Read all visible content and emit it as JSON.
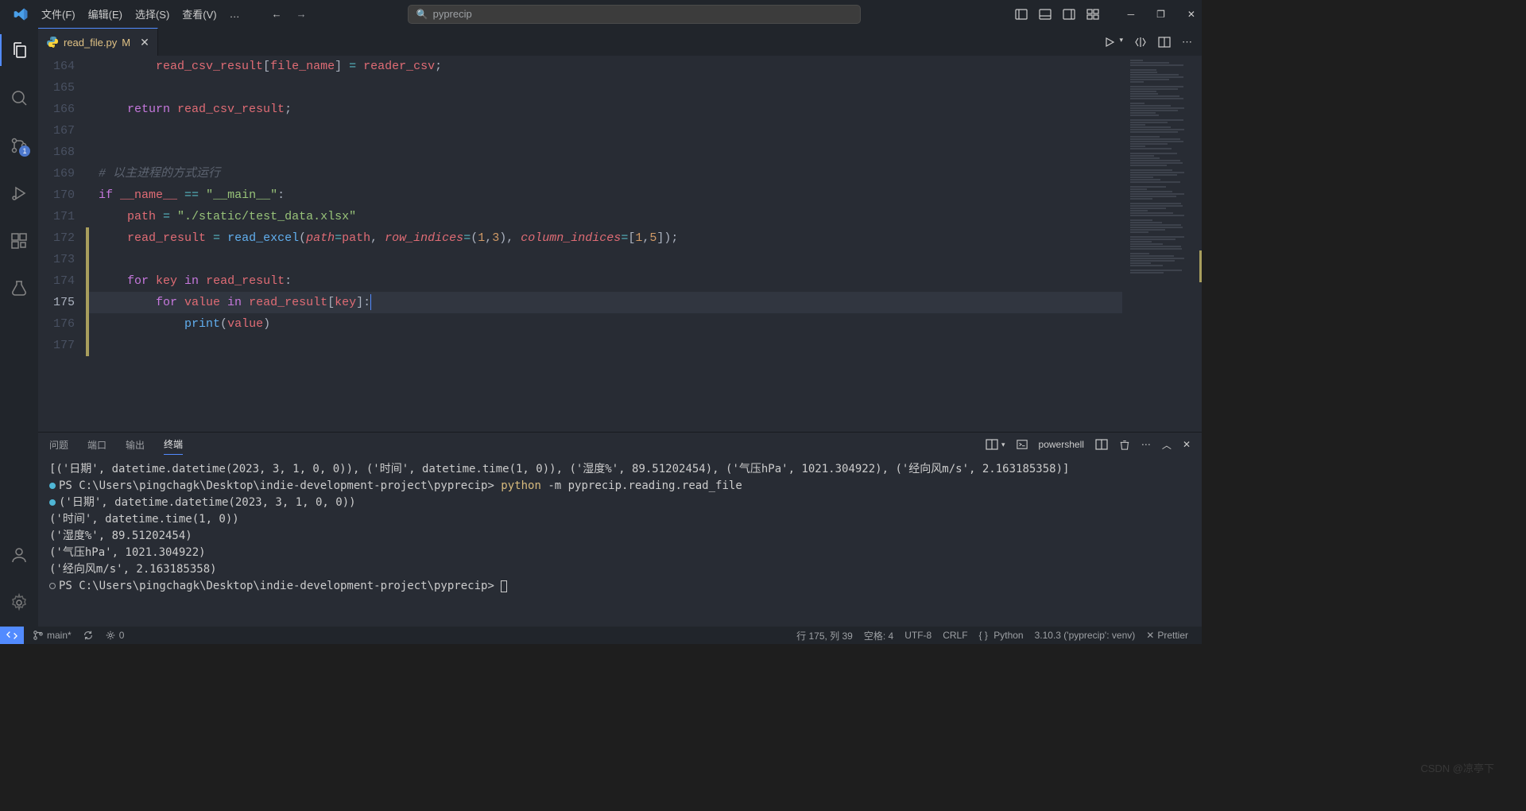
{
  "menu": {
    "file": "文件(F)",
    "edit": "编辑(E)",
    "select": "选择(S)",
    "view": "查看(V)",
    "dots": "…"
  },
  "search": {
    "placeholder": "pyprecip"
  },
  "tab": {
    "filename": "read_file.py",
    "modified": "M"
  },
  "source_control_badge": "1",
  "code": {
    "lines": [
      {
        "n": 164,
        "segs": [
          {
            "t": "        ",
            "c": "sy-pl"
          },
          {
            "t": "read_csv_result",
            "c": "sy-var"
          },
          {
            "t": "[",
            "c": "sy-pl"
          },
          {
            "t": "file_name",
            "c": "sy-var"
          },
          {
            "t": "] ",
            "c": "sy-pl"
          },
          {
            "t": "=",
            "c": "sy-op"
          },
          {
            "t": " reader_csv",
            "c": "sy-var"
          },
          {
            "t": ";",
            "c": "sy-pl"
          }
        ]
      },
      {
        "n": 165,
        "segs": []
      },
      {
        "n": 166,
        "segs": [
          {
            "t": "    ",
            "c": "sy-pl"
          },
          {
            "t": "return",
            "c": "sy-kw"
          },
          {
            "t": " read_csv_result",
            "c": "sy-var"
          },
          {
            "t": ";",
            "c": "sy-pl"
          }
        ]
      },
      {
        "n": 167,
        "segs": []
      },
      {
        "n": 168,
        "segs": []
      },
      {
        "n": 169,
        "segs": [
          {
            "t": "# 以主进程的方式运行",
            "c": "sy-cm"
          }
        ]
      },
      {
        "n": 170,
        "segs": [
          {
            "t": "if",
            "c": "sy-kw"
          },
          {
            "t": " __name__ ",
            "c": "sy-var"
          },
          {
            "t": "==",
            "c": "sy-op"
          },
          {
            "t": " ",
            "c": "sy-pl"
          },
          {
            "t": "\"__main__\"",
            "c": "sy-str"
          },
          {
            "t": ":",
            "c": "sy-pl"
          }
        ]
      },
      {
        "n": 171,
        "segs": [
          {
            "t": "    path ",
            "c": "sy-var"
          },
          {
            "t": "=",
            "c": "sy-op"
          },
          {
            "t": " ",
            "c": "sy-pl"
          },
          {
            "t": "\"./static/test_data.xlsx\"",
            "c": "sy-str"
          }
        ]
      },
      {
        "n": 172,
        "mod": true,
        "segs": [
          {
            "t": "    read_result ",
            "c": "sy-var"
          },
          {
            "t": "=",
            "c": "sy-op"
          },
          {
            "t": " ",
            "c": "sy-pl"
          },
          {
            "t": "read_excel",
            "c": "sy-fn"
          },
          {
            "t": "(",
            "c": "sy-pl"
          },
          {
            "t": "path",
            "c": "sy-prm"
          },
          {
            "t": "=",
            "c": "sy-op"
          },
          {
            "t": "path",
            "c": "sy-var"
          },
          {
            "t": ", ",
            "c": "sy-pl"
          },
          {
            "t": "row_indices",
            "c": "sy-prm"
          },
          {
            "t": "=",
            "c": "sy-op"
          },
          {
            "t": "(",
            "c": "sy-pl"
          },
          {
            "t": "1",
            "c": "sy-num"
          },
          {
            "t": ",",
            "c": "sy-pl"
          },
          {
            "t": "3",
            "c": "sy-num"
          },
          {
            "t": "), ",
            "c": "sy-pl"
          },
          {
            "t": "column_indices",
            "c": "sy-prm"
          },
          {
            "t": "=",
            "c": "sy-op"
          },
          {
            "t": "[",
            "c": "sy-pl"
          },
          {
            "t": "1",
            "c": "sy-num"
          },
          {
            "t": ",",
            "c": "sy-pl"
          },
          {
            "t": "5",
            "c": "sy-num"
          },
          {
            "t": "]);",
            "c": "sy-pl"
          }
        ]
      },
      {
        "n": 173,
        "mod": true,
        "segs": []
      },
      {
        "n": 174,
        "mod": true,
        "segs": [
          {
            "t": "    ",
            "c": "sy-pl"
          },
          {
            "t": "for",
            "c": "sy-kw"
          },
          {
            "t": " key ",
            "c": "sy-var"
          },
          {
            "t": "in",
            "c": "sy-kw"
          },
          {
            "t": " read_result",
            "c": "sy-var"
          },
          {
            "t": ":",
            "c": "sy-pl"
          }
        ]
      },
      {
        "n": 175,
        "mod": true,
        "current": true,
        "segs": [
          {
            "t": "        ",
            "c": "sy-pl"
          },
          {
            "t": "for",
            "c": "sy-kw"
          },
          {
            "t": " value ",
            "c": "sy-var"
          },
          {
            "t": "in",
            "c": "sy-kw"
          },
          {
            "t": " read_result",
            "c": "sy-var"
          },
          {
            "t": "[",
            "c": "sy-pl"
          },
          {
            "t": "key",
            "c": "sy-var"
          },
          {
            "t": "]:",
            "c": "sy-pl"
          }
        ],
        "cursor": true
      },
      {
        "n": 176,
        "mod": true,
        "segs": [
          {
            "t": "            ",
            "c": "sy-pl"
          },
          {
            "t": "print",
            "c": "sy-fn"
          },
          {
            "t": "(",
            "c": "sy-pl"
          },
          {
            "t": "value",
            "c": "sy-var"
          },
          {
            "t": ")",
            "c": "sy-pl"
          }
        ]
      },
      {
        "n": 177,
        "mod": true,
        "segs": []
      }
    ]
  },
  "panel": {
    "tabs": {
      "problems": "问题",
      "ports": "端口",
      "output": "输出",
      "terminal": "终端"
    },
    "shell": "powershell"
  },
  "terminal": {
    "l1": "[('日期', datetime.datetime(2023, 3, 1, 0, 0)), ('时间', datetime.time(1, 0)), ('湿度%', 89.51202454), ('气压hPa', 1021.304922), ('经向风m/s', 2.163185358)]",
    "l2a": "PS C:\\Users\\pingchagk\\Desktop\\indie-development-project\\pyprecip> ",
    "l2b": "python ",
    "l2c": "-m pyprecip.reading.read_file",
    "l3": "('日期', datetime.datetime(2023, 3, 1, 0, 0))",
    "l4": "('时间', datetime.time(1, 0))",
    "l5": "('湿度%', 89.51202454)",
    "l6": "('气压hPa', 1021.304922)",
    "l7": "('经向风m/s', 2.163185358)",
    "l8": "PS C:\\Users\\pingchagk\\Desktop\\indie-development-project\\pyprecip> "
  },
  "status": {
    "branch": "main*",
    "ports": "0",
    "cursor": "行 175, 列 39",
    "spaces": "空格: 4",
    "encoding": "UTF-8",
    "eol": "CRLF",
    "lang": "Python",
    "interp": "3.10.3 ('pyprecip': venv)",
    "prettier": "Prettier"
  },
  "watermark": "CSDN @凉亭下"
}
